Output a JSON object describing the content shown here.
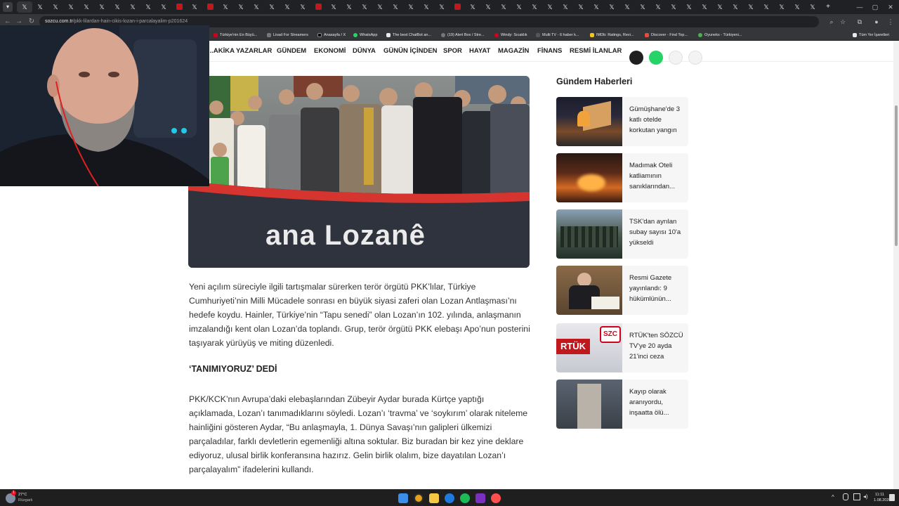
{
  "browser": {
    "tabs_count": 52,
    "url_host": "sozcu.com.tr",
    "url_path": "/pkk-lilardan-hain-cikis-lozan-i-parcalayalim-p201624",
    "bookmarks": [
      "Türkiye'nin En Büyü...",
      "Livad For Streamers",
      "Anasayfa / X",
      "WhatsApp",
      "The best ChatBot an...",
      "(19) Alert Box / Stre...",
      "Windy: Sıcaklık",
      "Multi TV - 6 haber k...",
      "IMDb: Ratings, Revi...",
      "Discover - Find Top...",
      "Oyuneks - Türkiyeni..."
    ],
    "bookmarks_folder": "Tüm Yer İşaretleri"
  },
  "nav": {
    "items": [
      "...AKİKA",
      "YAZARLAR",
      "GÜNDEM",
      "EKONOMİ",
      "DÜNYA",
      "GÜNÜN İÇİNDEN",
      "SPOR",
      "HAYAT",
      "MAGAZİN",
      "FİNANS",
      "RESMİ İLANLAR"
    ]
  },
  "article": {
    "banner_text": "ana Lozanê",
    "paragraph1": "Yeni açılım süreciyle ilgili tartışmalar sürerken terör örgütü PKK’lılar, Türkiye Cumhuriyeti’nin Milli Mücadele sonrası en büyük siyasi zaferi olan Lozan Antlaşması’nı hedefe koydu. Hainler, Türkiye’nin “Tapu senedi” olan Lozan’ın 102. yılında, anlaşmanın imzalandığı kent olan Lozan’da toplandı. Grup, terör örgütü PKK elebaşı Apo’nun posterini taşıyarak yürüyüş ve miting düzenledi.",
    "subheading": "‘TANIMIYORUZ’ DEDİ",
    "paragraph2": "PKK/KCK’nın Avrupa’daki elebaşlarından Zübeyir Aydar burada Kürtçe yaptığı açıklamada, Lozan’ı tanımadıklarını söyledi. Lozan’ı ‘travma’ ve ‘soykırım’ olarak niteleme hainliğini gösteren Aydar, “Bu anlaşmayla, 1. Dünya Savaşı’nın galipleri ülkemizi parçaladılar, farklı devletlerin egemenliği altına soktular. Biz buradan bir kez yine deklare ediyoruz, ulusal birlik konferansına hazırız.  Gelin birlik olalım, bize dayatılan Lozan’ı parçalayalım” ifadelerini kullandı."
  },
  "sidebar": {
    "title": "Gündem Haberleri",
    "items": [
      {
        "title": "Gümüşhane'de 3 katlı otelde korkutan yangın"
      },
      {
        "title": "Madımak Oteli katliamının sanıklarından..."
      },
      {
        "title": "TSK'dan ayrılan subay sayısı 10'a yükseldi"
      },
      {
        "title": "Resmi Gazete yayınlandı: 9 hükümlünün..."
      },
      {
        "title": "RTÜK'ten SÖZCÜ TV'ye 20 ayda 21'inci ceza"
      },
      {
        "title": "Kayıp olarak aranıyordu, inşaatta ölü..."
      }
    ],
    "thumb_labels": {
      "rtuk": "RTÜK",
      "szc": "SZC"
    }
  },
  "taskbar": {
    "weather_temp": "27°C",
    "weather_desc": "Rüzgarlı",
    "notif_badge": "1",
    "time": "11:11",
    "date": "1.08.2025"
  },
  "colors": {
    "chrome_dark": "#202124",
    "chrome_mid": "#35363a",
    "sozcu_red": "#d0021b",
    "banner_red": "#d6342f"
  }
}
